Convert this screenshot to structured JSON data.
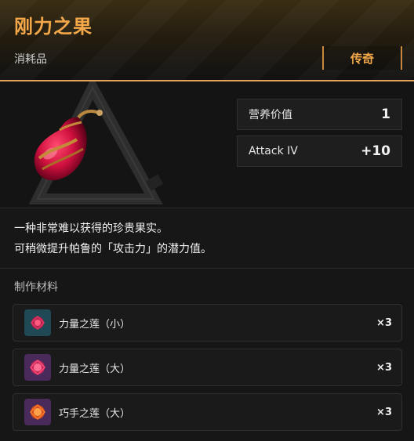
{
  "item": {
    "name": "刚力之果",
    "category": "消耗品",
    "rarity": "传奇",
    "icon": "red-fruit-pendant-icon"
  },
  "stats": [
    {
      "label": "营养价值",
      "value": "1"
    },
    {
      "label": "Attack IV",
      "value": "+10"
    }
  ],
  "description": [
    "一种非常难以获得的珍贵果实。",
    "可稍微提升帕鲁的「攻击力」的潜力值。"
  ],
  "materials": {
    "title": "制作材料",
    "items": [
      {
        "name": "力量之莲（小）",
        "quantity": "×3",
        "icon": "small-lotus-icon",
        "icon_bg": "#1f4a55"
      },
      {
        "name": "力量之莲（大）",
        "quantity": "×3",
        "icon": "large-lotus-icon",
        "icon_bg": "#4a2a5a"
      },
      {
        "name": "巧手之莲（大）",
        "quantity": "×3",
        "icon": "dexterity-lotus-icon",
        "icon_bg": "#4a2a5a"
      }
    ]
  },
  "colors": {
    "accent": "#f5a84a",
    "divider": "#e9a25a"
  }
}
